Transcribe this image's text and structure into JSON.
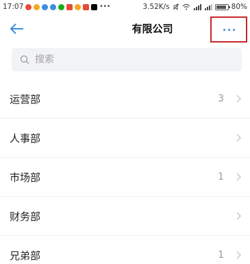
{
  "status_bar": {
    "time": "17:07",
    "speed": "3.52K/s",
    "battery": "80%",
    "battery_level": 0.8
  },
  "header": {
    "title": "有限公司",
    "back_icon": "arrow-left-icon",
    "more_icon": "more-dots-icon",
    "accent_color": "#3b8de0",
    "highlight_color": "#c8262b"
  },
  "search": {
    "placeholder": "搜索",
    "value": ""
  },
  "departments": [
    {
      "name": "运营部",
      "count": "3"
    },
    {
      "name": "人事部",
      "count": ""
    },
    {
      "name": "市场部",
      "count": "1"
    },
    {
      "name": "财务部",
      "count": ""
    },
    {
      "name": "兄弟部",
      "count": "1"
    }
  ]
}
